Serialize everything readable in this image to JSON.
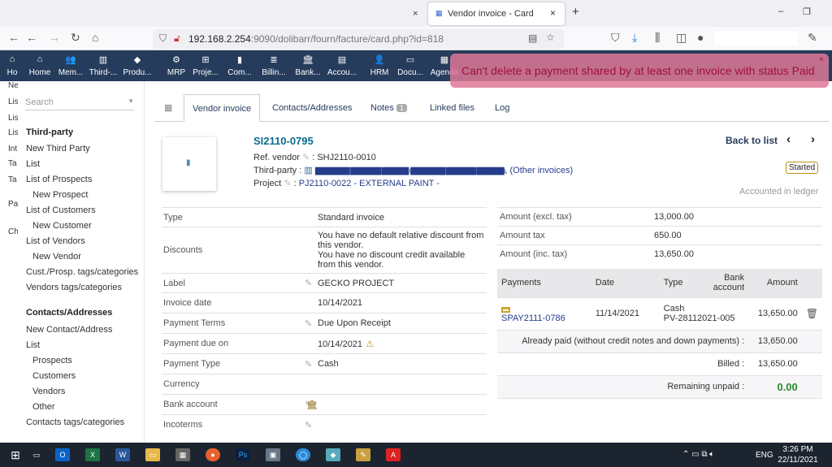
{
  "browser": {
    "inactive_tab_close": "×",
    "active_tab_title": "Vendor invoice - Card",
    "active_tab_close": "×",
    "new_tab": "+",
    "url_host": "192.168.2.254",
    "url_path": ":9090/dolibarr/fourn/facture/card.php?id=818"
  },
  "topmenu": [
    {
      "icon": "⌂",
      "label": "Ho"
    },
    {
      "icon": "⌂",
      "label": "Home"
    },
    {
      "icon": "👥",
      "label": "Mem..."
    },
    {
      "icon": "▥",
      "label": "Third-..."
    },
    {
      "icon": "◆",
      "label": "Produ..."
    },
    {
      "icon": "⚙",
      "label": "MRP"
    },
    {
      "icon": "⊞",
      "label": "Proje..."
    },
    {
      "icon": "▮",
      "label": "Com..."
    },
    {
      "icon": "≣",
      "label": "Billin..."
    },
    {
      "icon": "🏛",
      "label": "Bank..."
    },
    {
      "icon": "▤",
      "label": "Accou..."
    },
    {
      "icon": "👤",
      "label": "HRM"
    },
    {
      "icon": "▭",
      "label": "Docu..."
    },
    {
      "icon": "▦",
      "label": "Agenda"
    }
  ],
  "toast": {
    "message": "Can't delete a payment shared by at least one invoice with status Paid",
    "close": "×"
  },
  "strip": [
    "Ne",
    "Lis",
    "Lis",
    "Lis",
    "Int",
    "Ta",
    "Ta",
    "Pa",
    "Ch"
  ],
  "sidebar": {
    "search_placeholder": "Search",
    "items": [
      {
        "label": "Third-party",
        "type": "h"
      },
      {
        "label": "New Third Party"
      },
      {
        "label": "List"
      },
      {
        "label": "List of Prospects"
      },
      {
        "label": "New Prospect",
        "type": "sub"
      },
      {
        "label": "List of Customers"
      },
      {
        "label": "New Customer",
        "type": "sub"
      },
      {
        "label": "List of Vendors"
      },
      {
        "label": "New Vendor",
        "type": "sub"
      },
      {
        "label": "Cust./Prosp. tags/categories"
      },
      {
        "label": "Vendors tags/categories"
      },
      {
        "label": "Contacts/Addresses",
        "type": "h"
      },
      {
        "label": "New Contact/Address"
      },
      {
        "label": "List"
      },
      {
        "label": "Prospects",
        "type": "sub"
      },
      {
        "label": "Customers",
        "type": "sub"
      },
      {
        "label": "Vendors",
        "type": "sub"
      },
      {
        "label": "Other",
        "type": "sub"
      },
      {
        "label": "Contacts tags/categories"
      }
    ]
  },
  "tabs": [
    {
      "label": "Vendor invoice"
    },
    {
      "label": "Contacts/Addresses"
    },
    {
      "label": "Notes",
      "badge": "1"
    },
    {
      "label": "Linked files"
    },
    {
      "label": "Log"
    }
  ],
  "header": {
    "ref": "SI2110-0795",
    "ref_vendor_label": "Ref. vendor",
    "ref_vendor": "SHJ2110-0010",
    "thirdparty_label": "Third-party",
    "thirdparty_name": "█████████ ████████ ███████ (█████████ ████████ ███████)",
    "other_invoices": "(Other invoices)",
    "project_label": "Project",
    "project": "PJ2110-0022 - EXTERNAL PAINT -",
    "back_to_list": "Back to list",
    "status": "Started",
    "accounted": "Accounted in ledger"
  },
  "fields": [
    {
      "label": "Type",
      "value": "Standard invoice"
    },
    {
      "label": "Discounts",
      "value": "You have no default relative discount from this vendor.\nYou have no discount credit available from this vendor."
    },
    {
      "label": "Label",
      "value": "GECKO PROJECT",
      "edit": true
    },
    {
      "label": "Invoice date",
      "value": "10/14/2021"
    },
    {
      "label": "Payment Terms",
      "value": "Due Upon Receipt",
      "edit": true
    },
    {
      "label": "Payment due on",
      "value": "10/14/2021",
      "warning": true
    },
    {
      "label": "Payment Type",
      "value": "Cash",
      "edit": true
    },
    {
      "label": "Currency",
      "value": ""
    },
    {
      "label": "Bank account",
      "value": "",
      "edit": true,
      "bank": true
    },
    {
      "label": "Incoterms",
      "value": "",
      "edit": true
    }
  ],
  "amounts": [
    {
      "label": "Amount (excl. tax)",
      "value": "13,000.00"
    },
    {
      "label": "Amount tax",
      "value": "650.00"
    },
    {
      "label": "Amount (inc. tax)",
      "value": "13,650.00"
    }
  ],
  "payments": {
    "headers": [
      "Payments",
      "Date",
      "Type",
      "Bank account",
      "Amount"
    ],
    "rows": [
      {
        "ref": "SPAY2111-0786",
        "date": "11/14/2021",
        "type": "Cash",
        "type_ref": "PV-28112021-005",
        "amount": "13,650.00"
      }
    ],
    "already_paid_label": "Already paid (without credit notes and down payments) :",
    "already_paid": "13,650.00",
    "billed_label": "Billed :",
    "billed": "13,650.00",
    "remaining_label": "Remaining unpaid :",
    "remaining": "0.00"
  },
  "taskbar": {
    "lang": "ENG",
    "time": "3:26 PM",
    "date": "22/11/2021"
  },
  "colors": {
    "topmenu": "#263c5c",
    "link": "#263c8c",
    "remaining": "#2a8a2a",
    "toast": "#de7896"
  }
}
